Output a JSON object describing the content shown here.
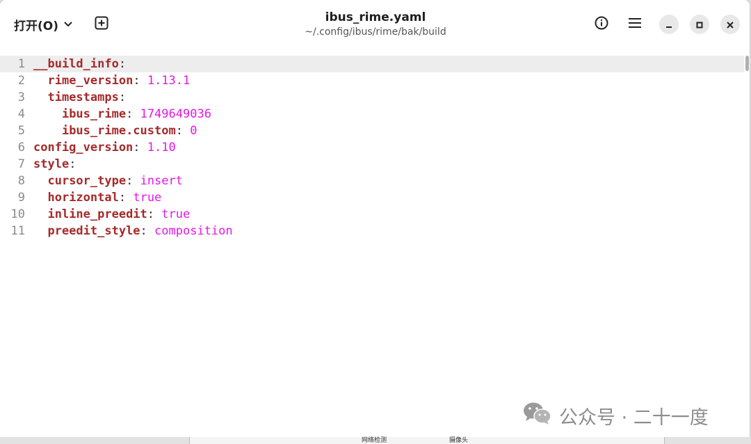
{
  "header": {
    "open_label": "打开(O)",
    "title": "ibus_rime.yaml",
    "subtitle": "~/.config/ibus/rime/bak/build"
  },
  "icons": {
    "open_dropdown": "chevron-down-icon",
    "new_tab": "new-tab-icon",
    "info": "info-icon",
    "menu": "hamburger-menu-icon",
    "minimize": "minimize-icon",
    "maximize": "maximize-icon",
    "close": "close-icon"
  },
  "editor": {
    "current_line": 1,
    "lines": [
      {
        "n": "1",
        "indent": "",
        "key": "__build_info",
        "value": ""
      },
      {
        "n": "2",
        "indent": "  ",
        "key": "rime_version",
        "value": "1.13.1"
      },
      {
        "n": "3",
        "indent": "  ",
        "key": "timestamps",
        "value": ""
      },
      {
        "n": "4",
        "indent": "    ",
        "key": "ibus_rime",
        "value": "1749649036"
      },
      {
        "n": "5",
        "indent": "    ",
        "key": "ibus_rime.custom",
        "value": "0"
      },
      {
        "n": "6",
        "indent": "",
        "key": "config_version",
        "value": "1.10"
      },
      {
        "n": "7",
        "indent": "",
        "key": "style",
        "value": ""
      },
      {
        "n": "8",
        "indent": "  ",
        "key": "cursor_type",
        "value": "insert"
      },
      {
        "n": "9",
        "indent": "  ",
        "key": "horizontal",
        "value": "true"
      },
      {
        "n": "10",
        "indent": "  ",
        "key": "inline_preedit",
        "value": "true"
      },
      {
        "n": "11",
        "indent": "  ",
        "key": "preedit_style",
        "value": "composition"
      }
    ]
  },
  "watermark": {
    "text": "公众号 · 二十一度",
    "icon": "wechat-icon"
  },
  "background": {
    "cell1": "网络检测",
    "cell2": "摄像头"
  },
  "colors": {
    "key": "#a52a2a",
    "value": "#e616e6",
    "line_number": "#8a8a8a",
    "current_line_bg": "#ededed"
  }
}
